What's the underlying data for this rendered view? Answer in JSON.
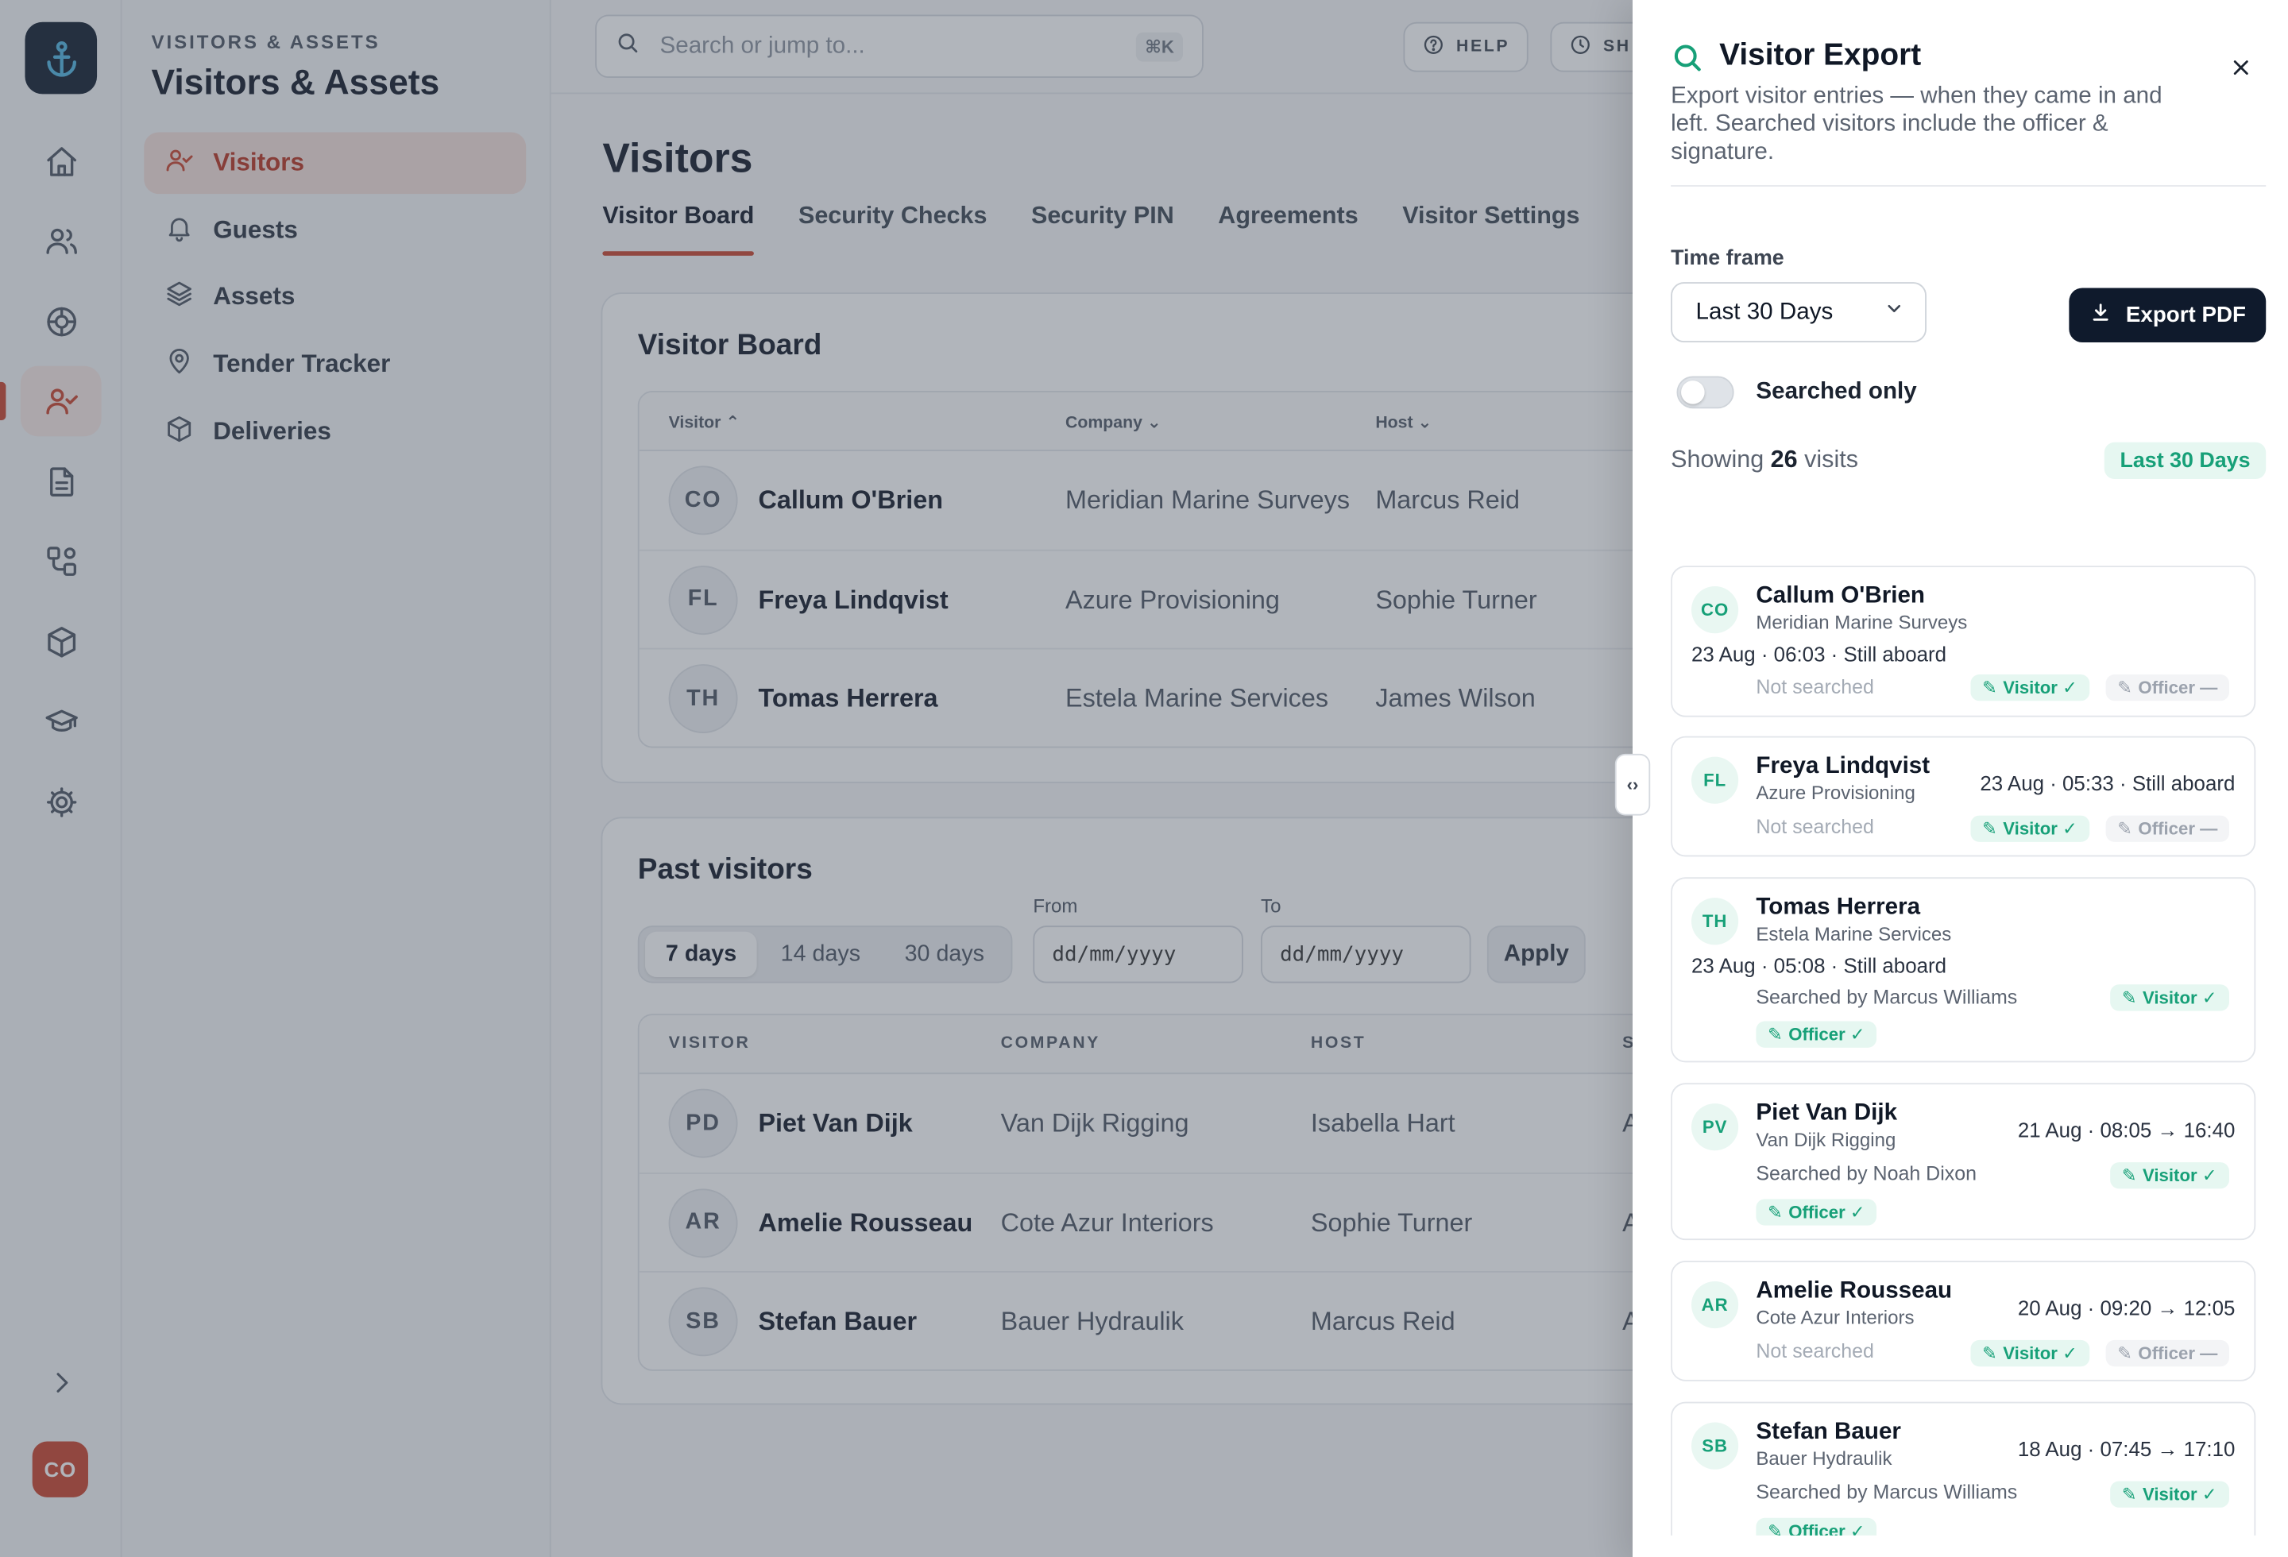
{
  "app": {
    "section_eyebrow": "VISITORS & ASSETS",
    "section_title": "Visitors & Assets",
    "user_initials": "CO"
  },
  "subnav": {
    "items": [
      {
        "label": "Visitors"
      },
      {
        "label": "Guests"
      },
      {
        "label": "Assets"
      },
      {
        "label": "Tender Tracker"
      },
      {
        "label": "Deliveries"
      }
    ]
  },
  "topbar": {
    "search_placeholder": "Search or jump to...",
    "search_shortcut": "⌘K",
    "help_label": "HELP",
    "second_label": "SH"
  },
  "page": {
    "title": "Visitors",
    "tabs": [
      {
        "label": "Visitor Board"
      },
      {
        "label": "Security Checks"
      },
      {
        "label": "Security PIN"
      },
      {
        "label": "Agreements"
      },
      {
        "label": "Visitor Settings"
      }
    ]
  },
  "visitor_board": {
    "title": "Visitor Board",
    "columns": {
      "visitor": "Visitor",
      "company": "Company",
      "host": "Host"
    },
    "rows": [
      {
        "initials": "CO",
        "name": "Callum O'Brien",
        "company": "Meridian Marine Surveys",
        "host": "Marcus Reid"
      },
      {
        "initials": "FL",
        "name": "Freya Lindqvist",
        "company": "Azure Provisioning",
        "host": "Sophie Turner"
      },
      {
        "initials": "TH",
        "name": "Tomas Herrera",
        "company": "Estela Marine Services",
        "host": "James Wilson"
      }
    ]
  },
  "past_visitors": {
    "title": "Past visitors",
    "ranges": [
      "7 days",
      "14 days",
      "30 days"
    ],
    "from_label": "From",
    "to_label": "To",
    "date_placeholder": "dd/mm/yyyy",
    "apply_label": "Apply",
    "columns": {
      "visitor": "VISITOR",
      "company": "COMPANY",
      "host": "HOST",
      "status": "S"
    },
    "rows": [
      {
        "initials": "PD",
        "name": "Piet Van Dijk",
        "company": "Van Dijk Rigging",
        "host": "Isabella Hart",
        "status": "A"
      },
      {
        "initials": "AR",
        "name": "Amelie Rousseau",
        "company": "Cote Azur Interiors",
        "host": "Sophie Turner",
        "status": "A"
      },
      {
        "initials": "SB",
        "name": "Stefan Bauer",
        "company": "Bauer Hydraulik",
        "host": "Marcus Reid",
        "status": "A"
      }
    ]
  },
  "drawer": {
    "title": "Visitor Export",
    "description": "Export visitor entries — when they came in and left. Searched visitors include the officer & signature.",
    "time_frame_label": "Time frame",
    "time_frame_value": "Last 30 Days",
    "export_label": "Export PDF",
    "searched_only_label": "Searched only",
    "searched_only_on": false,
    "showing_prefix": "Showing",
    "showing_count": "26",
    "showing_suffix": "visits",
    "range_badge": "Last 30 Days",
    "visitor_pill": "Visitor ✓",
    "officer_done_pill": "Officer ✓",
    "officer_pending_pill": "Officer —",
    "visits": [
      {
        "initials": "CO",
        "name": "Callum O'Brien",
        "company": "Meridian Marine Surveys",
        "time": "23 Aug · 06:03 · Still aboard",
        "search": "Not searched"
      },
      {
        "initials": "FL",
        "name": "Freya Lindqvist",
        "company": "Azure Provisioning",
        "time": "23 Aug · 05:33 · Still aboard",
        "search": "Not searched"
      },
      {
        "initials": "TH",
        "name": "Tomas Herrera",
        "company": "Estela Marine Services",
        "time": "23 Aug · 05:08 · Still aboard",
        "search": "Searched by Marcus Williams"
      },
      {
        "initials": "PV",
        "name": "Piet Van Dijk",
        "company": "Van Dijk Rigging",
        "time": "21 Aug · 08:05 → 16:40",
        "search": "Searched by Noah Dixon"
      },
      {
        "initials": "AR",
        "name": "Amelie Rousseau",
        "company": "Cote Azur Interiors",
        "time": "20 Aug · 09:20 → 12:05",
        "search": "Not searched"
      },
      {
        "initials": "SB",
        "name": "Stefan Bauer",
        "company": "Bauer Hydraulik",
        "time": "18 Aug · 07:45 → 17:10",
        "search": "Searched by Marcus Williams"
      }
    ]
  },
  "colors": {
    "accent": "#c8432c",
    "navy": "#0f1a2c",
    "success": "#17a078"
  },
  "icons": {
    "logo": "anchor-icon",
    "rail": [
      "home-icon",
      "users-icon",
      "lifebuoy-icon",
      "user-check-icon",
      "document-icon",
      "workflow-icon",
      "box-icon",
      "graduation-cap-icon",
      "gear-icon"
    ],
    "expand": "chevron-right-icon"
  }
}
